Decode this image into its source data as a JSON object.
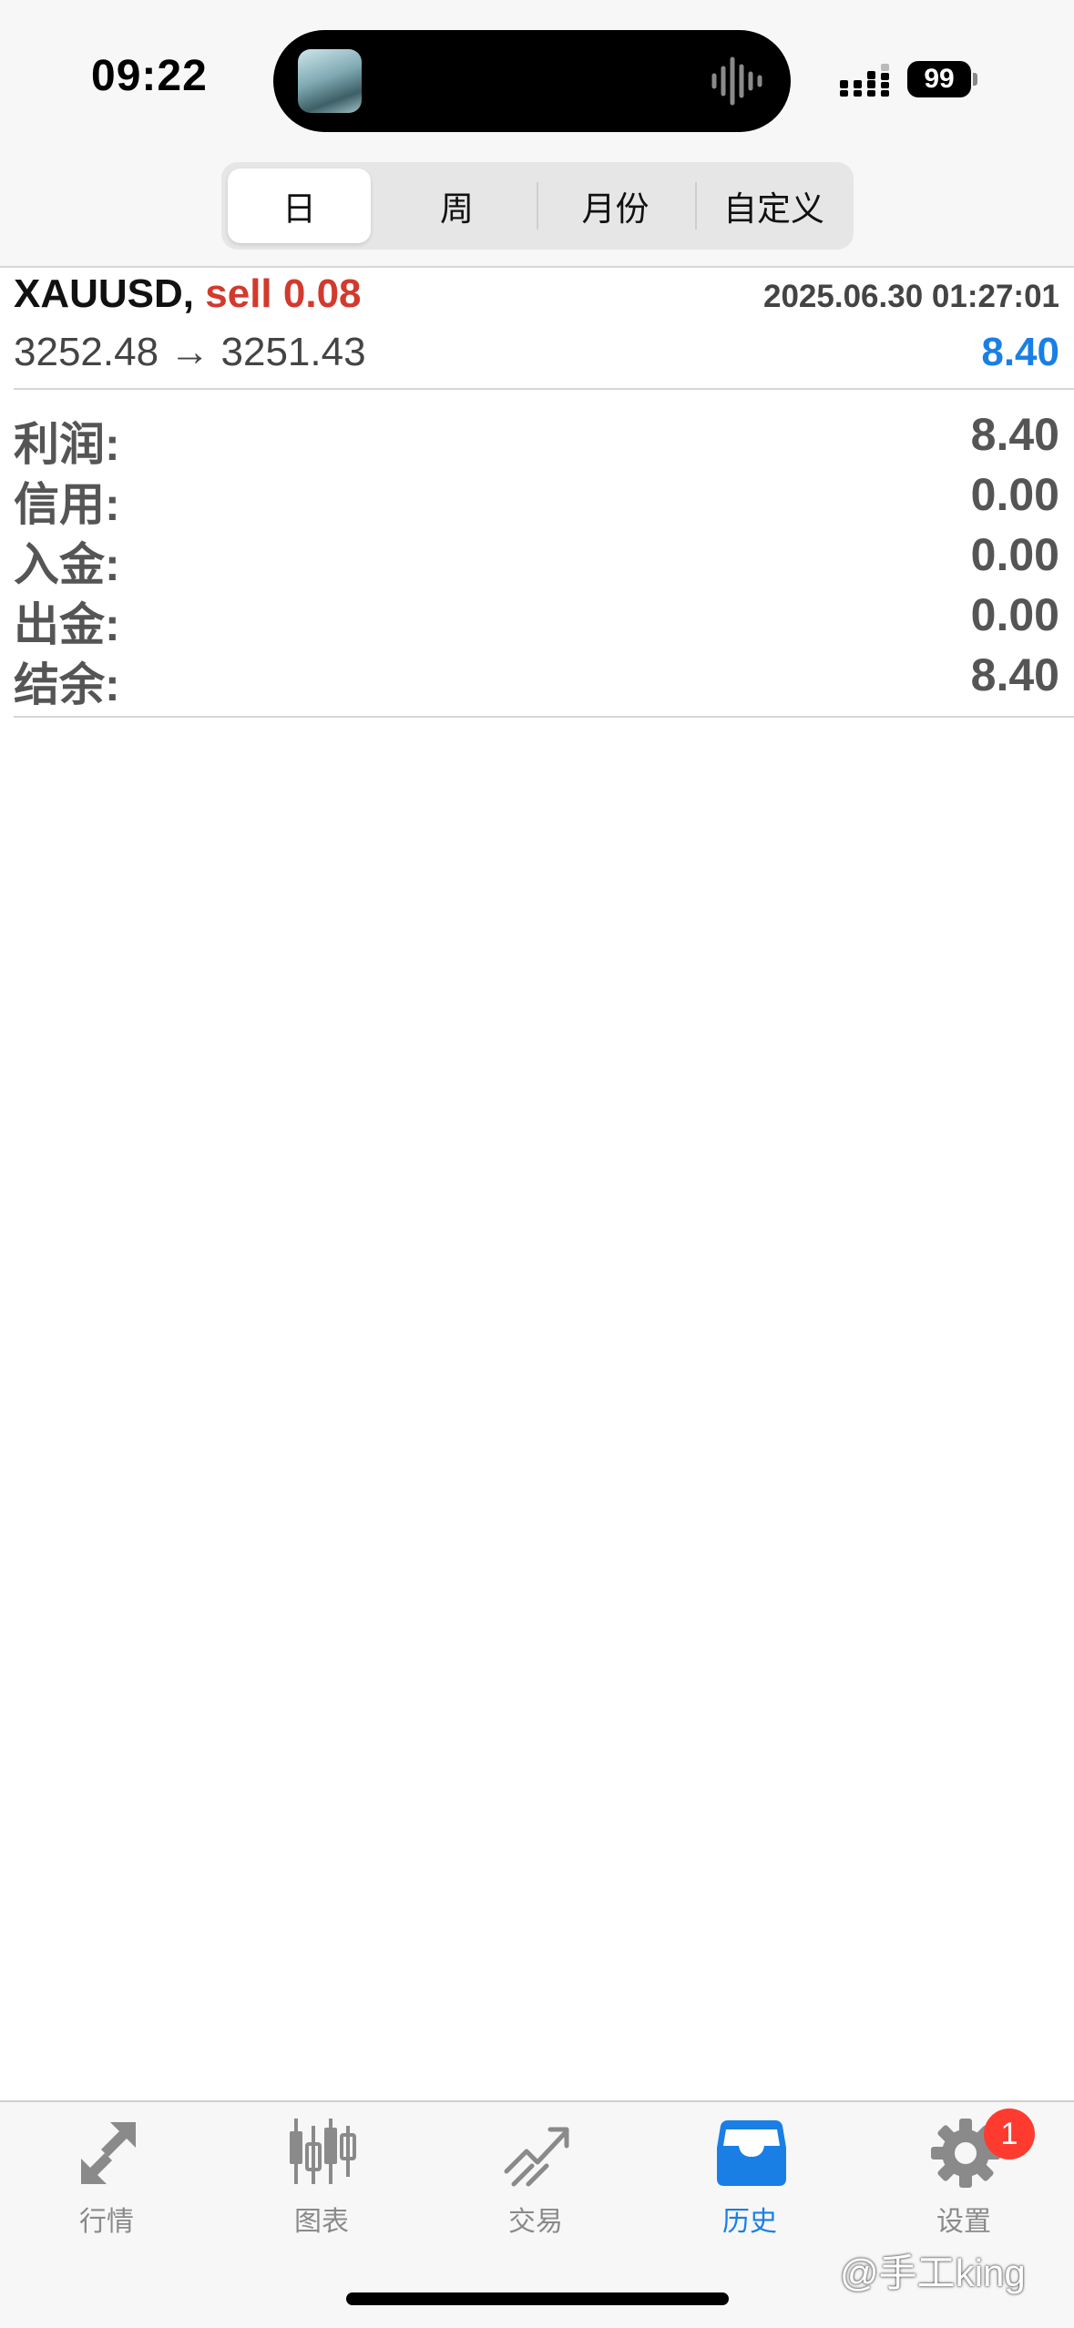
{
  "status_bar": {
    "time": "09:22",
    "battery": "99"
  },
  "period_tabs": [
    {
      "label": "日",
      "selected": true
    },
    {
      "label": "周",
      "selected": false
    },
    {
      "label": "月份",
      "selected": false
    },
    {
      "label": "自定义",
      "selected": false
    }
  ],
  "trade": {
    "symbol": "XAUUSD,",
    "side_volume": "sell 0.08",
    "datetime": "2025.06.30 01:27:01",
    "prices": "3252.48 → 3251.43",
    "profit": "8.40"
  },
  "summary": [
    {
      "label": "利润:",
      "value": "8.40"
    },
    {
      "label": "信用:",
      "value": "0.00"
    },
    {
      "label": "入金:",
      "value": "0.00"
    },
    {
      "label": "出金:",
      "value": "0.00"
    },
    {
      "label": "结余:",
      "value": "8.40"
    }
  ],
  "tabbar": {
    "items": [
      {
        "label": "行情",
        "icon": "quotes-arrows-icon"
      },
      {
        "label": "图表",
        "icon": "candlestick-chart-icon"
      },
      {
        "label": "交易",
        "icon": "trade-trend-icon"
      },
      {
        "label": "历史",
        "icon": "inbox-tray-icon",
        "active": true
      },
      {
        "label": "设置",
        "icon": "gear-icon"
      }
    ],
    "settings_badge": "1"
  },
  "watermark": "@手工king",
  "colors": {
    "accent": "#1a7fe5",
    "sell": "#d23a2e",
    "badge": "#ff3b30"
  }
}
